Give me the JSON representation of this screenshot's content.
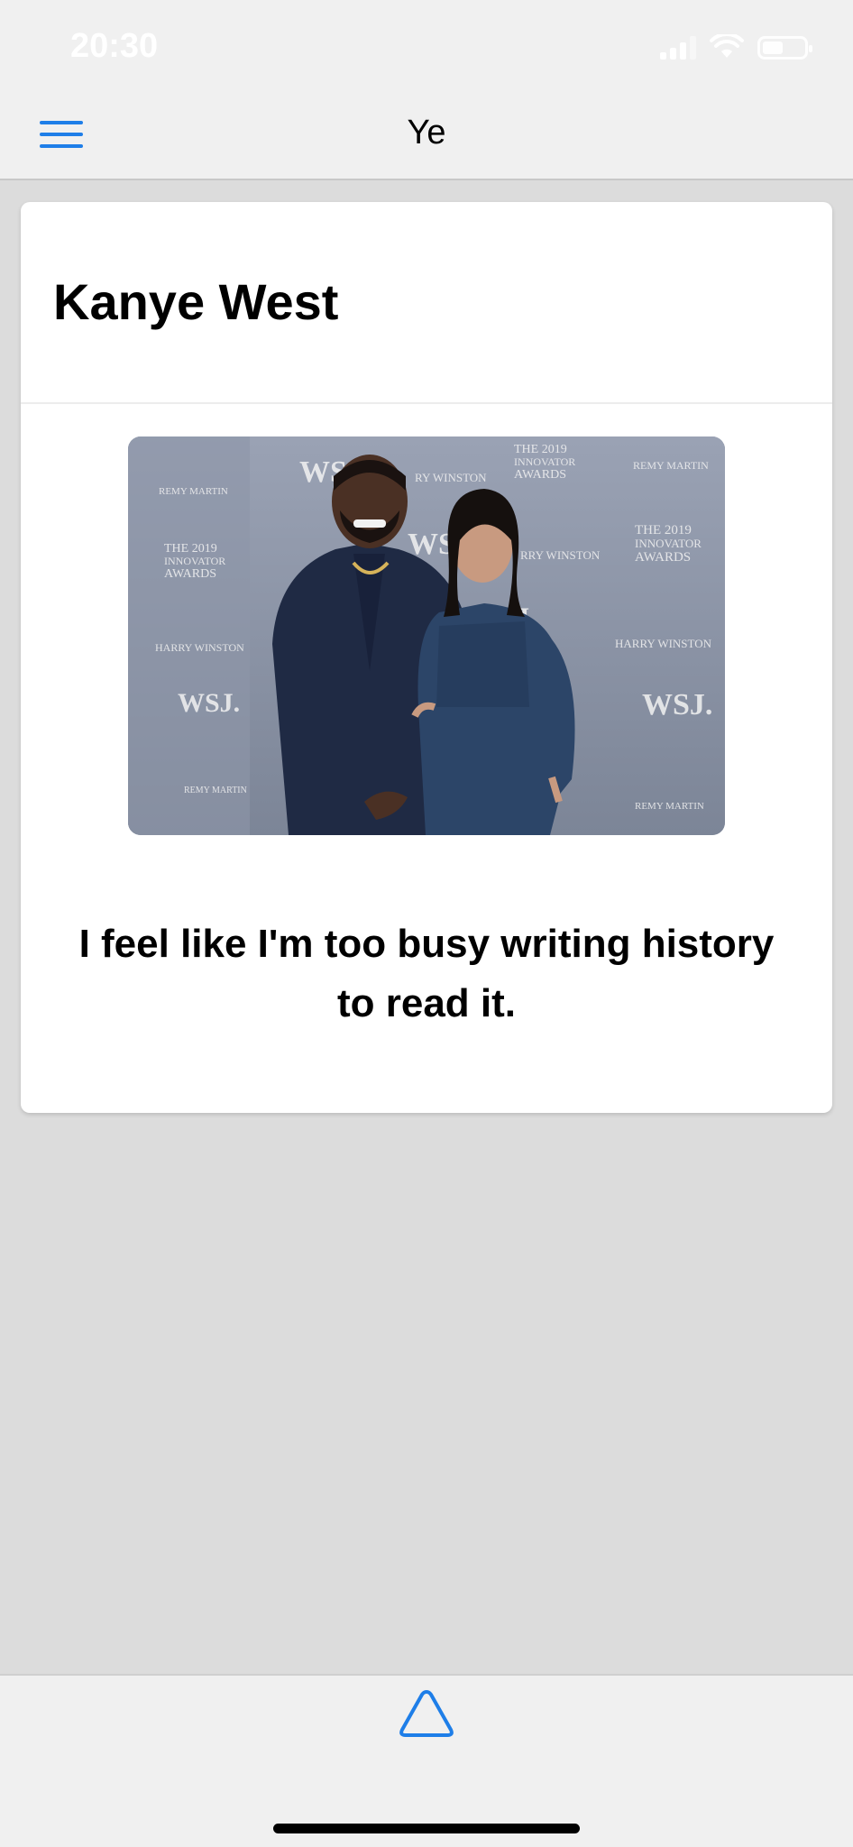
{
  "status_bar": {
    "time": "20:30"
  },
  "nav": {
    "title": "Ye"
  },
  "card": {
    "title": "Kanye West",
    "quote": "I feel like I'm too busy writing history to read it."
  },
  "icons": {
    "menu": "hamburger-icon",
    "bottom": "triangle-icon"
  },
  "colors": {
    "accent": "#1e7ee8",
    "background": "#dcdcdc",
    "bar": "#f0f0f0",
    "card": "#ffffff"
  }
}
